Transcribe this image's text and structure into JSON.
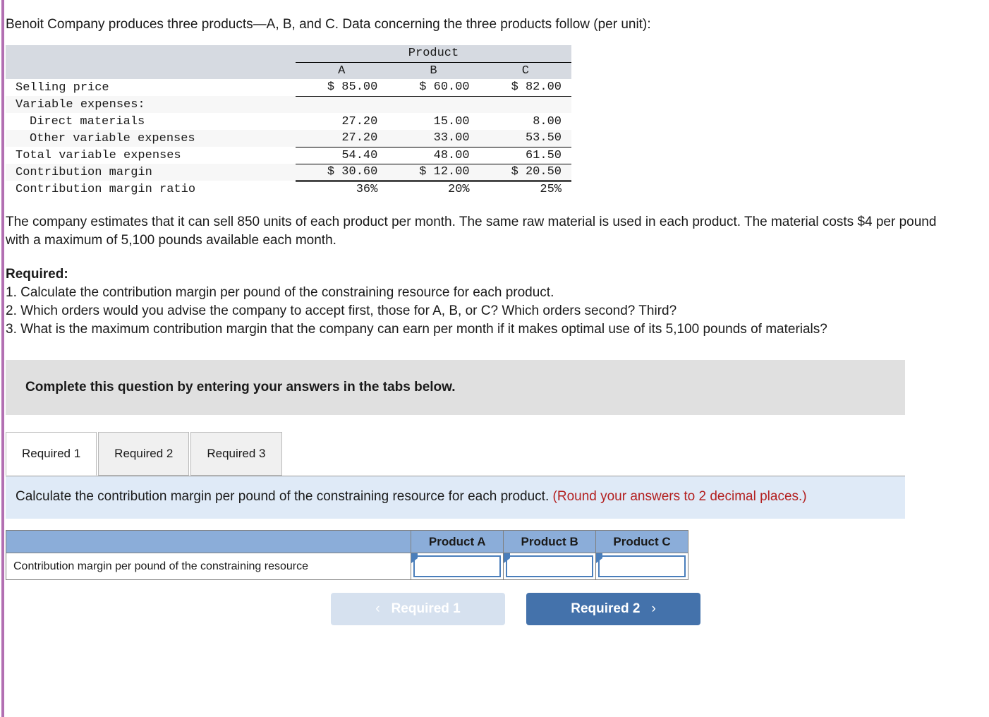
{
  "intro": "Benoit Company produces three products—A, B, and C. Data concerning the three products follow (per unit):",
  "data_table": {
    "group_header": "Product",
    "columns": [
      "A",
      "B",
      "C"
    ],
    "rows": [
      {
        "label": "Selling price",
        "indent": false,
        "values": [
          "$ 85.00",
          "$ 60.00",
          "$ 82.00"
        ]
      },
      {
        "label": "Variable expenses:",
        "indent": false,
        "values": [
          "",
          "",
          ""
        ]
      },
      {
        "label": "Direct materials",
        "indent": true,
        "values": [
          "27.20",
          "15.00",
          "8.00"
        ]
      },
      {
        "label": "Other variable expenses",
        "indent": true,
        "values": [
          "27.20",
          "33.00",
          "53.50"
        ]
      },
      {
        "label": "Total variable expenses",
        "indent": false,
        "values": [
          "54.40",
          "48.00",
          "61.50"
        ]
      },
      {
        "label": "Contribution margin",
        "indent": false,
        "values": [
          "$ 30.60",
          "$ 12.00",
          "$ 20.50"
        ]
      },
      {
        "label": "Contribution margin ratio",
        "indent": false,
        "values": [
          "36%",
          "20%",
          "25%"
        ]
      }
    ]
  },
  "paragraph": "The company estimates that it can sell 850 units of each product per month. The same raw material is used in each product. The material costs $4 per pound with a maximum of 5,100 pounds available each month.",
  "required": {
    "heading": "Required:",
    "items": [
      "1. Calculate the contribution margin per pound of the constraining resource for each product.",
      "2. Which orders would you advise the company to accept first, those for A, B, or C? Which orders second? Third?",
      "3. What is the maximum contribution margin that the company can earn per month if it makes optimal use of its 5,100 pounds of materials?"
    ]
  },
  "banner": {
    "text": "Complete this question by entering your answers in the tabs below."
  },
  "tabs": [
    {
      "label": "Required 1",
      "active": true
    },
    {
      "label": "Required 2",
      "active": false
    },
    {
      "label": "Required 3",
      "active": false
    }
  ],
  "instruction": {
    "main": "Calculate the contribution margin per pound of the constraining resource for each product.",
    "note": "(Round your answers to 2 decimal places.)"
  },
  "answer_table": {
    "headers": [
      "",
      "Product A",
      "Product B",
      "Product C"
    ],
    "row_label": "Contribution margin per pound of the constraining resource",
    "values": [
      "",
      "",
      ""
    ]
  },
  "nav": {
    "prev_label": "Required 1",
    "next_label": "Required 2",
    "prev_icon": "chevron-left-icon",
    "next_icon": "chevron-right-icon",
    "prev_chevron": "‹",
    "next_chevron": "›"
  },
  "colors": {
    "accent_rule": "#b26fb2",
    "table_header_band": "#d6dae1",
    "banner_bg": "#e0e0e0",
    "panel_bg": "#dfeaf7",
    "note_red": "#b32020",
    "answer_header_blue": "#8badd9",
    "input_border_blue": "#4a7ebb",
    "next_button_blue": "#4472ab",
    "prev_button_blue": "#d6e1ef"
  }
}
